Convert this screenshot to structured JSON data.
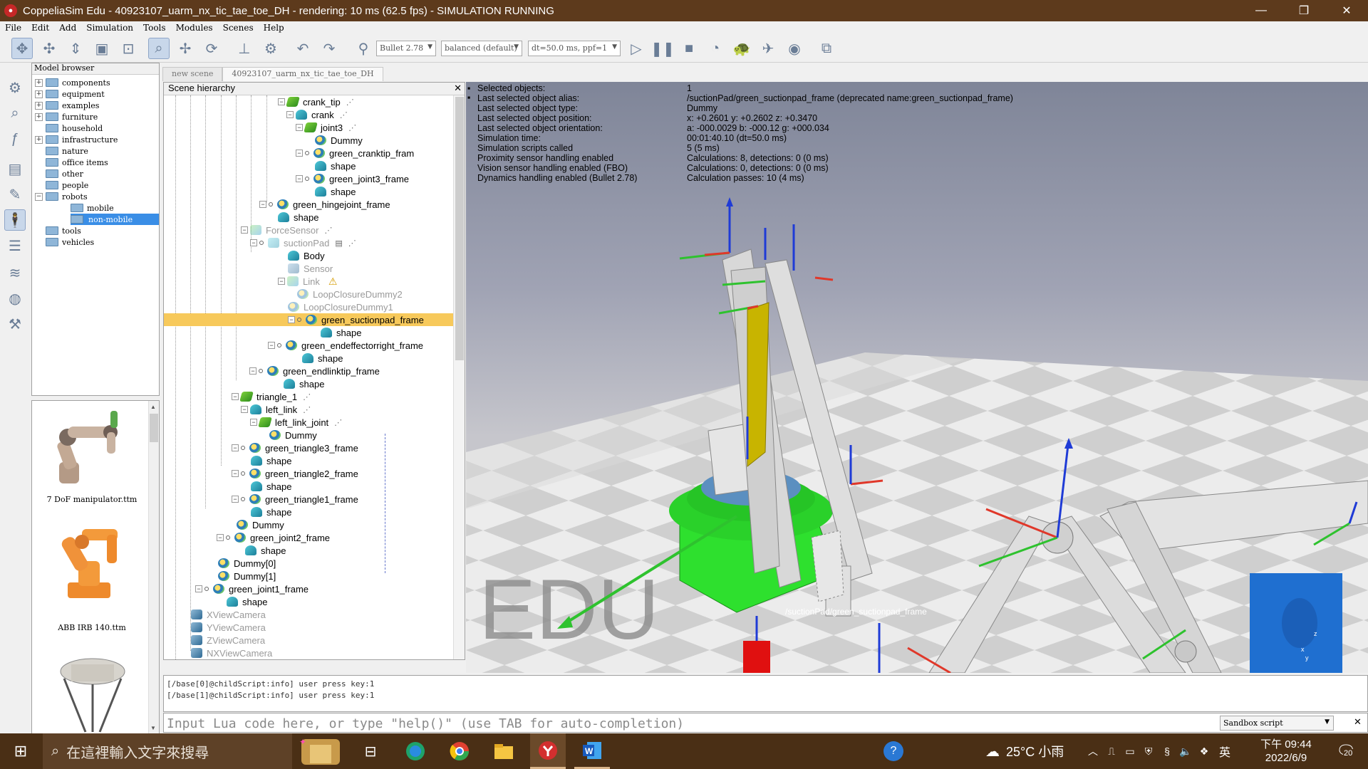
{
  "window": {
    "title": "CoppeliaSim Edu - 40923107_uarm_nx_tic_tae_toe_DH - rendering: 10 ms (62.5 fps) - SIMULATION RUNNING",
    "minimize": "—",
    "maximize": "❐",
    "close": "✕"
  },
  "menu": [
    "File",
    "Edit",
    "Add",
    "Simulation",
    "Tools",
    "Modules",
    "Scenes",
    "Help"
  ],
  "toolbar": {
    "engine": "Bullet 2.78",
    "mode": "balanced (default)",
    "timestep": "dt=50.0 ms, ppf=1"
  },
  "model_browser": {
    "title": "Model browser",
    "folders": [
      "components",
      "equipment",
      "examples",
      "furniture",
      "household",
      "infrastructure",
      "nature",
      "office items",
      "other",
      "people",
      "robots",
      "mobile",
      "non-mobile",
      "tools",
      "vehicles"
    ],
    "thumbnails": [
      "7 DoF manipulator.ttm",
      "ABB IRB 140.ttm"
    ]
  },
  "tabs": [
    "new scene",
    "40923107_uarm_nx_tic_tae_toe_DH"
  ],
  "hierarchy": {
    "title": "Scene hierarchy",
    "close": "✕",
    "items": [
      "crank_tip",
      "crank",
      "joint3",
      "Dummy",
      "green_cranktip_fram",
      "shape",
      "green_joint3_frame",
      "shape",
      "green_hingejoint_frame",
      "shape",
      "ForceSensor",
      "suctionPad",
      "Body",
      "Sensor",
      "Link",
      "LoopClosureDummy2",
      "LoopClosureDummy1",
      "green_suctionpad_frame",
      "shape",
      "green_endeffectorright_frame",
      "shape",
      "green_endlinktip_frame",
      "shape",
      "triangle_1",
      "left_link",
      "left_link_joint",
      "Dummy",
      "green_triangle3_frame",
      "shape",
      "green_triangle2_frame",
      "shape",
      "green_triangle1_frame",
      "shape",
      "Dummy",
      "green_joint2_frame",
      "shape",
      "Dummy[0]",
      "Dummy[1]",
      "green_joint1_frame",
      "shape",
      "XViewCamera",
      "YViewCamera",
      "ZViewCamera",
      "NXViewCamera"
    ]
  },
  "info": {
    "labels": [
      "Selected objects:",
      "Last selected object alias:",
      "Last selected object type:",
      "Last selected object position:",
      "Last selected object orientation:",
      "Simulation time:",
      "Simulation scripts called",
      "Proximity sensor handling enabled",
      "Vision sensor handling enabled (FBO)",
      "Dynamics handling enabled (Bullet 2.78)"
    ],
    "values": [
      "1",
      "/suctionPad/green_suctionpad_frame   (deprecated name:green_suctionpad_frame)",
      "Dummy",
      "x: +0.2601   y: +0.2602   z: +0.3470",
      "a: -000.0029   b: -000.12   g: +000.034",
      "00:01:40.10 (dt=50.0 ms)",
      "5 (5 ms)",
      "Calculations: 8, detections: 0 (0 ms)",
      "Calculations: 0, detections: 0 (0 ms)",
      "Calculation passes: 10 (4 ms)"
    ]
  },
  "viewport": {
    "watermark": "EDU",
    "selection_label": "/suctionPad/green_suctionpad_frame",
    "axis_labels": [
      "z",
      "x",
      "y"
    ]
  },
  "console": {
    "lines": [
      "[/base[0]@childScript:info] user press key:1",
      "[/base[1]@childScript:info] user press key:1"
    ],
    "placeholder": "Input Lua code here, or type \"help()\" (use TAB for auto-completion)",
    "script_type": "Sandbox script",
    "close": "✕"
  },
  "taskbar": {
    "search": "在這裡輸入文字來搜尋",
    "weather": "25°C 小雨",
    "ime": "英",
    "time": "下午 09:44",
    "date": "2022/6/9",
    "notifications": "20"
  },
  "colors": {
    "titlebar": "#5d3a1c",
    "taskbar": "#4a2f15",
    "selection": "#f7c95b",
    "robot_green": "#2ee02e",
    "floor_light": "#ececec",
    "floor_dark": "#cfcfcf"
  }
}
